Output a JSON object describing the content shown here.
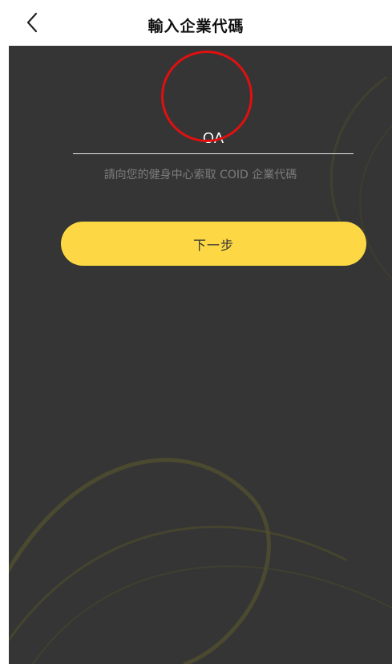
{
  "nav": {
    "back_icon": "chevron-left-icon",
    "title": "輸入企業代碼"
  },
  "form": {
    "code_value": "OA",
    "hint": "請向您的健身中心索取 COID 企業代碼",
    "next_label": "下一步"
  },
  "colors": {
    "background_dark": "#353535",
    "button_yellow": "#fdd844",
    "annotation_red": "#e01010",
    "swirl_olive": "#6b6a2a"
  }
}
